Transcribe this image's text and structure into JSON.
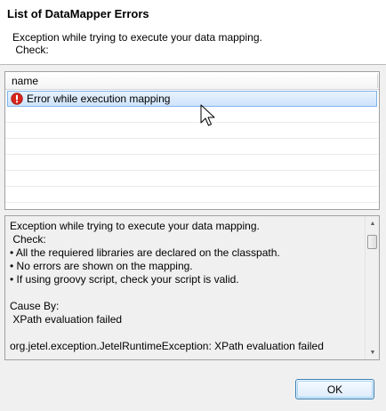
{
  "dialog": {
    "title": "List of DataMapper Errors",
    "message": "Exception while trying to execute your data mapping.\n Check:"
  },
  "errors_table": {
    "column_header": "name",
    "rows": [
      {
        "label": "Error while execution mapping",
        "icon": "error-icon",
        "selected": true
      }
    ]
  },
  "details": {
    "text": "Exception while trying to execute your data mapping.\n Check:\n• All the requiered libraries are declared on the classpath.\n• No errors are shown on the mapping.\n• If using groovy script, check your script is valid.\n\nCause By:\n XPath evaluation failed\n\norg.jetel.exception.JetelRuntimeException: XPath evaluation failed"
  },
  "buttons": {
    "ok_label": "OK"
  },
  "colors": {
    "selection": "#cfe3fb",
    "selection_border": "#7eb4ea",
    "error_icon": "#d9261c",
    "ok_button_border": "#3c7fb1"
  }
}
